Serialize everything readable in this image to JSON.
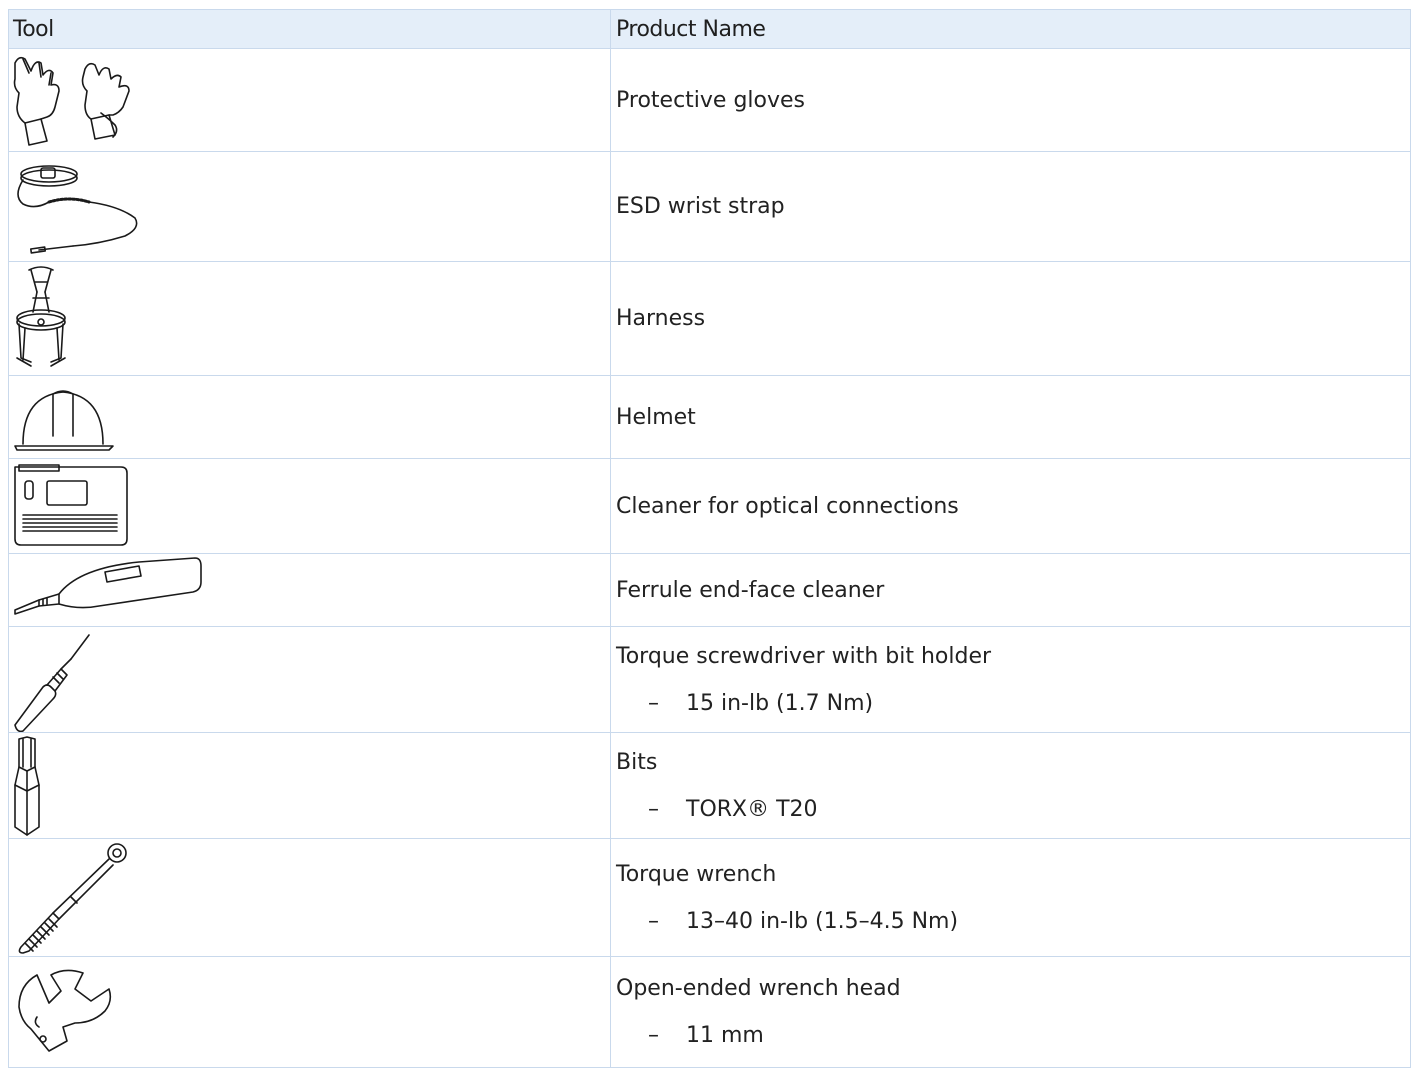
{
  "header": {
    "tool": "Tool",
    "product_name": "Product Name"
  },
  "rows": [
    {
      "icon": "protective-gloves-icon",
      "name": "Protective gloves"
    },
    {
      "icon": "esd-wrist-strap-icon",
      "name": "ESD wrist strap"
    },
    {
      "icon": "harness-icon",
      "name": "Harness"
    },
    {
      "icon": "helmet-icon",
      "name": "Helmet"
    },
    {
      "icon": "optical-cleaner-icon",
      "name": "Cleaner for optical connections"
    },
    {
      "icon": "ferrule-cleaner-icon",
      "name": "Ferrule end-face cleaner"
    },
    {
      "icon": "torque-screwdriver-icon",
      "name": "Torque screwdriver with bit holder",
      "dash": "–",
      "detail": "15 in-lb (1.7 Nm)"
    },
    {
      "icon": "torx-bit-icon",
      "name": "Bits",
      "dash": "–",
      "detail": "TORX® T20"
    },
    {
      "icon": "torque-wrench-icon",
      "name": "Torque wrench",
      "dash": "–",
      "detail": "13–40 in-lb (1.5–4.5 Nm)"
    },
    {
      "icon": "open-ended-wrench-icon",
      "name": "Open-ended wrench head",
      "dash": "–",
      "detail": "11 mm"
    }
  ]
}
